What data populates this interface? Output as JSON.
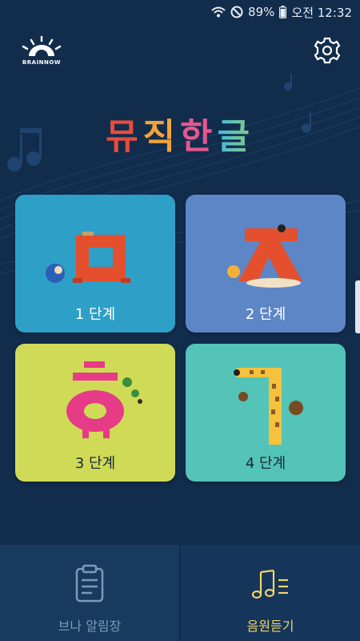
{
  "status_bar": {
    "battery": "89%",
    "time": "오전 12:32",
    "icons": [
      "wifi-icon",
      "do-not-disturb-icon",
      "battery-icon"
    ]
  },
  "header": {
    "logo_text": "BRAINNOW",
    "settings_icon": "gear-icon"
  },
  "title": "뮤직한글",
  "cards": [
    {
      "label": "1 단계",
      "color": "#2e9fc7",
      "art": "letter-mieum-icon"
    },
    {
      "label": "2 단계",
      "color": "#5d86c6",
      "art": "letter-jieut-icon"
    },
    {
      "label": "3 단계",
      "color": "#cfdb57",
      "art": "letter-hieut-icon"
    },
    {
      "label": "4 단계",
      "color": "#54c4b8",
      "art": "giraffe-icon"
    }
  ],
  "bottom_nav": {
    "left_label": "브나 알림장",
    "right_label": "음원듣기",
    "left_icon": "clipboard-icon",
    "right_icon": "music-list-icon",
    "accent": "#f2d568"
  }
}
